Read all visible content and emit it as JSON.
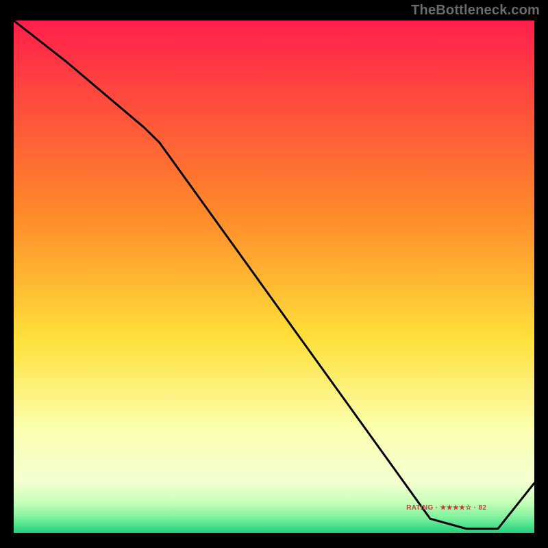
{
  "watermark": "TheBottleneck.com",
  "line_label": "RATING · ★★★★☆ · 82",
  "colors": {
    "bg_black": "#000000",
    "grad_top": "#ff1f4b",
    "grad_upper_mid": "#ff8a2a",
    "grad_mid": "#ffe03a",
    "grad_low": "#faffb0",
    "grad_band_1": "#f3ffd0",
    "grad_band_2": "#c8ffb8",
    "grad_band_3": "#7ef19d",
    "grad_bottom": "#1fd27a",
    "line": "#000000"
  },
  "chart_data": {
    "type": "line",
    "title": "",
    "xlabel": "",
    "ylabel": "",
    "xlim": [
      0,
      100
    ],
    "ylim": [
      0,
      100
    ],
    "x": [
      0,
      10,
      25,
      28,
      80,
      87,
      93,
      100
    ],
    "values": [
      100,
      92,
      79,
      76,
      2,
      0,
      0,
      9
    ],
    "annotations": [
      {
        "text_key": "line_label",
        "x": 82,
        "y": 3
      }
    ],
    "notes": "y encodes bottleneck severity (top=worst/red, bottom=best/green); curve drops from top-left, flattens near x≈83–90 at the baseline, then rises slightly toward x=100."
  }
}
